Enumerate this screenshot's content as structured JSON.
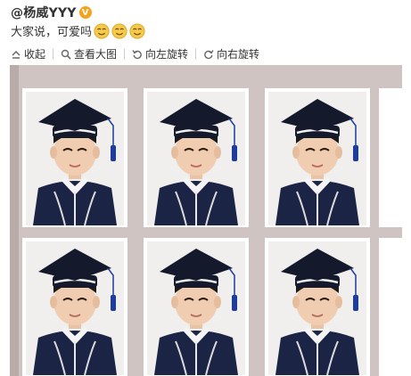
{
  "post": {
    "author": "@杨威YYY",
    "verified_badge": "V",
    "text": "大家说，可爱吗",
    "emoji": [
      "smile-emoji",
      "smile-emoji",
      "smile-emoji"
    ]
  },
  "toolbar": {
    "collapse": "收起",
    "view_large": "查看大图",
    "rotate_left": "向左旋转",
    "rotate_right": "向右旋转"
  },
  "colors": {
    "badge": "#f7a11c",
    "emoji": "#f6c94a",
    "cap": "#141a2c",
    "tassel": "#1e3c9a",
    "gown": "#1c2446",
    "photo_bg": "#f1efee",
    "sheet": "#cfc4c1"
  }
}
